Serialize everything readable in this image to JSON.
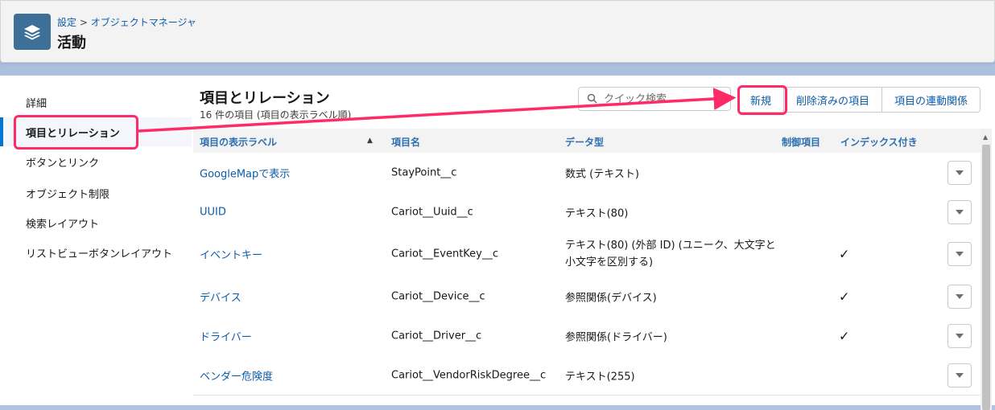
{
  "header": {
    "breadcrumb_setup": "設定",
    "breadcrumb_sep": " > ",
    "breadcrumb_object_manager": "オブジェクトマネージャ",
    "title": "活動",
    "icon": "layers-icon"
  },
  "sidebar": {
    "items": [
      {
        "label": "詳細"
      },
      {
        "label": "項目とリレーション"
      },
      {
        "label": "ボタンとリンク"
      },
      {
        "label": "オブジェクト制限"
      },
      {
        "label": "検索レイアウト"
      },
      {
        "label": "リストビューボタンレイアウト"
      }
    ]
  },
  "section": {
    "title": "項目とリレーション",
    "subtitle": "16 件の項目 (項目の表示ラベル順)"
  },
  "search": {
    "placeholder": "クイック検索"
  },
  "buttons": {
    "new": "新規",
    "deleted": "削除済みの項目",
    "dependencies": "項目の連動関係"
  },
  "table": {
    "columns": {
      "label": "項目の表示ラベル",
      "api_name": "項目名",
      "data_type": "データ型",
      "controlling": "制御項目",
      "indexed": "インデックス付き"
    },
    "rows": [
      {
        "label": "GoogleMapで表示",
        "api_name": "StayPoint__c",
        "data_type": "数式 (テキスト)",
        "indexed": ""
      },
      {
        "label": "UUID",
        "api_name": "Cariot__Uuid__c",
        "data_type": "テキスト(80)",
        "indexed": ""
      },
      {
        "label": "イベントキー",
        "api_name": "Cariot__EventKey__c",
        "data_type": "テキスト(80) (外部 ID) (ユニーク、大文字と小文字を区別する)",
        "indexed": "✓"
      },
      {
        "label": "デバイス",
        "api_name": "Cariot__Device__c",
        "data_type": "参照関係(デバイス)",
        "indexed": "✓"
      },
      {
        "label": "ドライバー",
        "api_name": "Cariot__Driver__c",
        "data_type": "参照関係(ドライバー)",
        "indexed": "✓"
      },
      {
        "label": "ベンダー危険度",
        "api_name": "Cariot__VendorRiskDegree__c",
        "data_type": "テキスト(255)",
        "indexed": ""
      }
    ]
  },
  "colors": {
    "accent": "#0176d3",
    "link": "#0b5cab",
    "annotation": "#ff2a68"
  }
}
